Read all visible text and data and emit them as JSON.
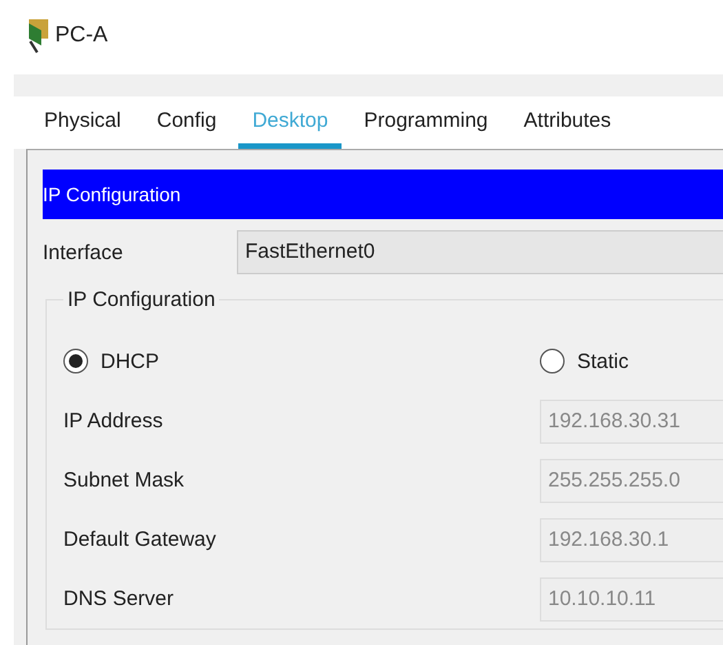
{
  "window": {
    "title": "PC-A"
  },
  "tabs": [
    {
      "label": "Physical",
      "selected": false
    },
    {
      "label": "Config",
      "selected": false
    },
    {
      "label": "Desktop",
      "selected": true
    },
    {
      "label": "Programming",
      "selected": false
    },
    {
      "label": "Attributes",
      "selected": false
    }
  ],
  "panel": {
    "title": "IP Configuration",
    "interface_label": "Interface",
    "interface_value": "FastEthernet0",
    "group_title": "IP Configuration",
    "modes": [
      {
        "label": "DHCP",
        "selected": true
      },
      {
        "label": "Static",
        "selected": false
      }
    ],
    "fields": [
      {
        "label": "IP Address",
        "value": "192.168.30.31"
      },
      {
        "label": "Subnet Mask",
        "value": "255.255.255.0"
      },
      {
        "label": "Default Gateway",
        "value": "192.168.30.1"
      },
      {
        "label": "DNS Server",
        "value": "10.10.10.11"
      }
    ]
  }
}
